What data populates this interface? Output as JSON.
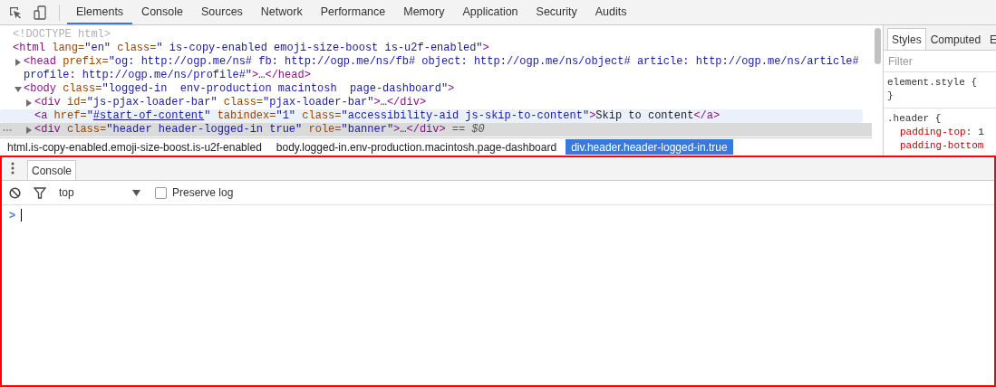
{
  "toolbar": {
    "tabs": [
      {
        "label": "Elements",
        "selected": true
      },
      {
        "label": "Console",
        "selected": false
      },
      {
        "label": "Sources",
        "selected": false
      },
      {
        "label": "Network",
        "selected": false
      },
      {
        "label": "Performance",
        "selected": false
      },
      {
        "label": "Memory",
        "selected": false
      },
      {
        "label": "Application",
        "selected": false
      },
      {
        "label": "Security",
        "selected": false
      },
      {
        "label": "Audits",
        "selected": false
      }
    ]
  },
  "dom_tree": [
    {
      "segments": [
        {
          "kind": "comment",
          "text": "<!DOCTYPE html>"
        }
      ],
      "selected": false,
      "hovered": false
    },
    {
      "segments": [
        {
          "kind": "tag",
          "text": "<html"
        },
        {
          "kind": "attr",
          "text": " lang="
        },
        {
          "kind": "value",
          "text": "\"en\""
        },
        {
          "kind": "attr",
          "text": " class="
        },
        {
          "kind": "value",
          "text": "\" is-copy-enabled emoji-size-boost is-u2f-enabled\""
        },
        {
          "kind": "tag",
          "text": ">"
        }
      ],
      "selected": false,
      "hovered": false,
      "children": [
        {
          "segments": [
            {
              "kind": "tag",
              "text": "<head"
            },
            {
              "kind": "attr",
              "text": " prefix="
            },
            {
              "kind": "value",
              "text": "\"og: http://ogp.me/ns# fb: http://ogp.me/ns/fb# object: http://ogp.me/ns/object# article: http://ogp.me/ns/article# profile: http://ogp.me/ns/profile#\""
            },
            {
              "kind": "tag",
              "text": ">"
            },
            {
              "kind": "plain",
              "text": "…"
            },
            {
              "kind": "tag",
              "text": "</head>"
            }
          ],
          "expanded": false,
          "selected": false,
          "hovered": false
        },
        {
          "segments": [
            {
              "kind": "tag",
              "text": "<body"
            },
            {
              "kind": "attr",
              "text": " class="
            },
            {
              "kind": "value",
              "text": "\"logged-in  env-production macintosh  page-dashboard\""
            },
            {
              "kind": "tag",
              "text": ">"
            }
          ],
          "expanded": true,
          "selected": false,
          "hovered": false,
          "children": [
            {
              "segments": [
                {
                  "kind": "tag",
                  "text": "<div"
                },
                {
                  "kind": "attr",
                  "text": " id="
                },
                {
                  "kind": "value",
                  "text": "\"js-pjax-loader-bar\""
                },
                {
                  "kind": "attr",
                  "text": " class="
                },
                {
                  "kind": "value",
                  "text": "\"pjax-loader-bar\""
                },
                {
                  "kind": "tag",
                  "text": ">"
                },
                {
                  "kind": "plain",
                  "text": "…"
                },
                {
                  "kind": "tag",
                  "text": "</div>"
                }
              ],
              "expanded": false,
              "selected": false,
              "hovered": false
            },
            {
              "segments": [
                {
                  "kind": "tag",
                  "text": "<a"
                },
                {
                  "kind": "attr",
                  "text": " href="
                },
                {
                  "kind": "value",
                  "text": "\""
                },
                {
                  "kind": "link",
                  "text": "#start-of-content"
                },
                {
                  "kind": "value",
                  "text": "\""
                },
                {
                  "kind": "attr",
                  "text": " tabindex="
                },
                {
                  "kind": "value",
                  "text": "\"1\""
                },
                {
                  "kind": "attr",
                  "text": " class="
                },
                {
                  "kind": "value",
                  "text": "\"accessibility-aid js-skip-to-content\""
                },
                {
                  "kind": "tag",
                  "text": ">"
                },
                {
                  "kind": "plain",
                  "text": "Skip to content"
                },
                {
                  "kind": "tag",
                  "text": "</a>"
                }
              ],
              "selected": false,
              "hovered": true
            },
            {
              "segments": [
                {
                  "kind": "tag",
                  "text": "<div"
                },
                {
                  "kind": "attr",
                  "text": " class="
                },
                {
                  "kind": "value",
                  "text": "\"header header-logged-in true\""
                },
                {
                  "kind": "attr",
                  "text": " role="
                },
                {
                  "kind": "value",
                  "text": "\"banner\""
                },
                {
                  "kind": "tag",
                  "text": ">"
                },
                {
                  "kind": "plain",
                  "text": "…"
                },
                {
                  "kind": "tag",
                  "text": "</div>"
                }
              ],
              "expanded": false,
              "selected": true,
              "hovered": false,
              "marker": "== $0"
            }
          ]
        }
      ]
    }
  ],
  "breadcrumbs": [
    {
      "label": "html.is-copy-enabled.emoji-size-boost.is-u2f-enabled",
      "selected": false
    },
    {
      "label": "body.logged-in.env-production.macintosh.page-dashboard",
      "selected": false
    },
    {
      "label": "div.header.header-logged-in.true",
      "selected": true
    }
  ],
  "styles_pane": {
    "tabs": [
      {
        "label": "Styles",
        "selected": true
      },
      {
        "label": "Computed",
        "selected": false
      },
      {
        "label": "E",
        "selected": false
      }
    ],
    "filter": {
      "placeholder": "Filter"
    },
    "rules": [
      {
        "selector_line": "element.style {",
        "close": "}"
      },
      {
        "selector_line": ".header {",
        "declarations": [
          {
            "property": "padding-top",
            "colon": ":",
            "value": "1"
          },
          {
            "property": "padding-bottom"
          }
        ]
      }
    ]
  },
  "drawer": {
    "tabs": [
      {
        "label": "Console",
        "selected": true
      }
    ],
    "context": "top",
    "preserve_log": {
      "label": "Preserve log",
      "checked": false
    },
    "prompt": ">"
  }
}
